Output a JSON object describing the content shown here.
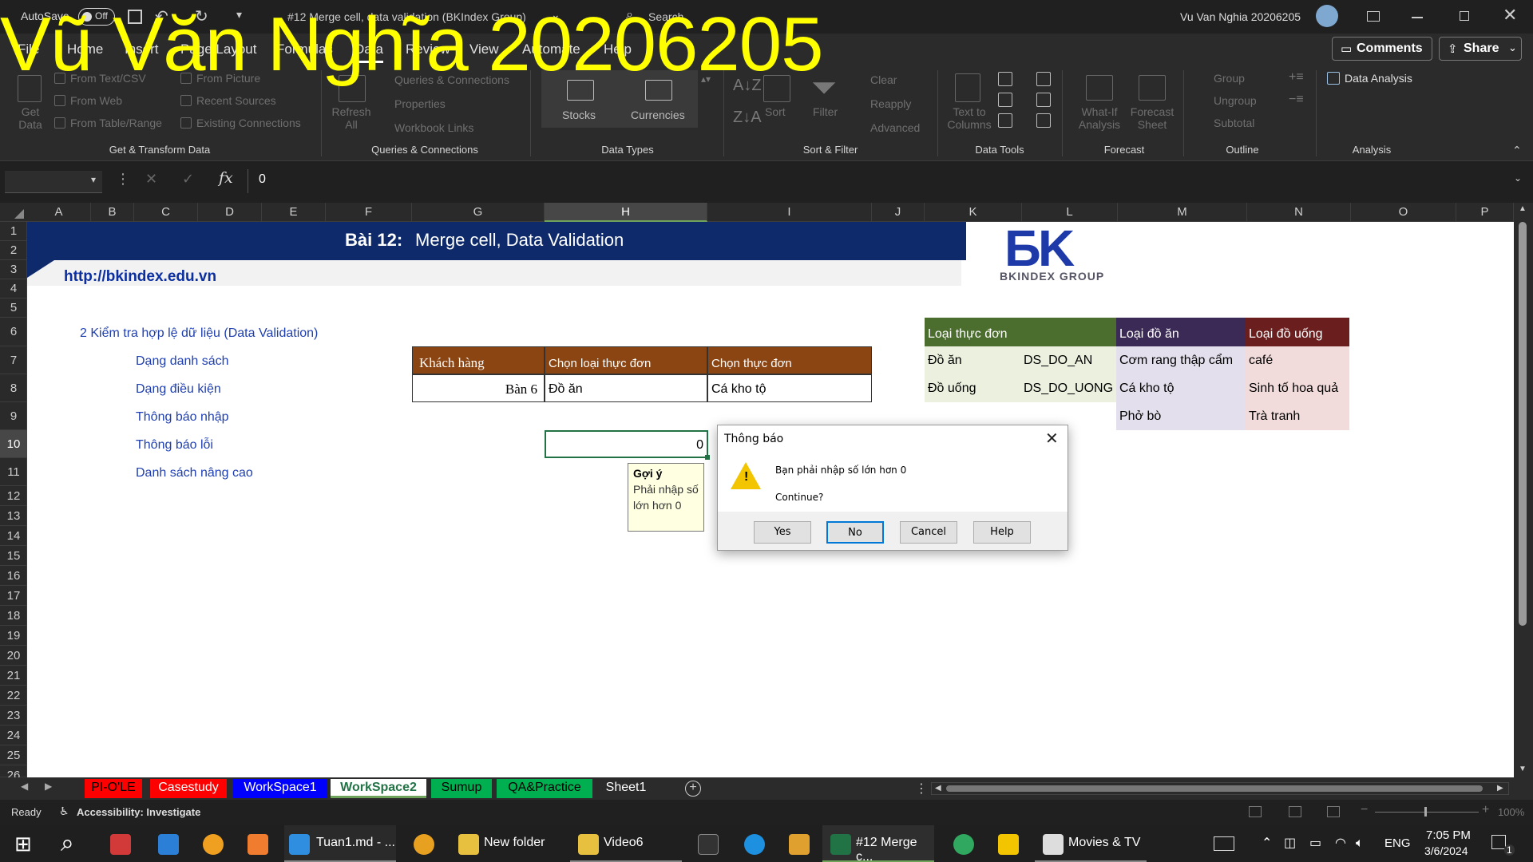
{
  "titlebar": {
    "autosave": "AutoSave",
    "toggle": "Off",
    "doc_title": "#12 Merge cell, data validation (BKIndex Group)",
    "search": "Search",
    "user": "Vu Van Nghia 20206205"
  },
  "watermark": "Vũ Văn Nghĩa 20206205",
  "menu": [
    "File",
    "Home",
    "Insert",
    "Page Layout",
    "Formulas",
    "Data",
    "Review",
    "View",
    "Automate",
    "Help"
  ],
  "menu_right": {
    "comments": "Comments",
    "share": "Share"
  },
  "ribbon": {
    "get_data": "Get Data",
    "from_text": "From Text/CSV",
    "from_web": "From Web",
    "from_table": "From Table/Range",
    "from_picture": "From Picture",
    "recent_sources": "Recent Sources",
    "existing_connections": "Existing Connections",
    "refresh": "Refresh All",
    "queries": "Queries & Connections",
    "properties": "Properties",
    "workbook_links": "Workbook Links",
    "stocks": "Stocks",
    "currencies": "Currencies",
    "sort": "Sort",
    "filter": "Filter",
    "clear": "Clear",
    "reapply": "Reapply",
    "advanced": "Advanced",
    "text_to_columns": "Text to Columns",
    "what_if": "What-If Analysis",
    "forecast_sheet": "Forecast Sheet",
    "group": "Group",
    "ungroup": "Ungroup",
    "subtotal": "Subtotal",
    "data_analysis": "Data Analysis",
    "groups": [
      "Get & Transform Data",
      "Queries & Connections",
      "Data Types",
      "Sort & Filter",
      "Data Tools",
      "Forecast",
      "Outline",
      "Analysis"
    ]
  },
  "formula": {
    "namebox": "",
    "fx": "fx",
    "value": "0"
  },
  "columns": [
    "A",
    "B",
    "C",
    "D",
    "E",
    "F",
    "G",
    "H",
    "I",
    "J",
    "K",
    "L",
    "M",
    "N",
    "O",
    "P"
  ],
  "rows": [
    "1",
    "2",
    "3",
    "4",
    "5",
    "6",
    "7",
    "8",
    "9",
    "10",
    "11",
    "12",
    "13",
    "14",
    "15",
    "16",
    "17",
    "18",
    "19",
    "20",
    "21",
    "22",
    "23",
    "24",
    "25",
    "26"
  ],
  "sheet": {
    "banner_label": "Bài 12:",
    "banner_title": "Merge cell, Data Validation",
    "url": "http://bkindex.edu.vn",
    "logo_mark": "ƂK",
    "logo_text": "BKINDEX GROUP",
    "section": "2  Kiểm tra hợp lệ dữ liệu (Data Validation)",
    "items": [
      "Dạng danh sách",
      "Dạng điều kiện",
      "Thông báo nhập",
      "Thông báo lỗi",
      "Danh sách nâng cao"
    ],
    "table_headers": [
      "Khách hàng",
      "Chọn loại thực đơn",
      "Chọn thực đơn"
    ],
    "table_row": [
      "Bàn 6",
      "Đồ ăn",
      "Cá kho tộ"
    ],
    "active_value": "0",
    "tooltip_title": "Gợi ý",
    "tooltip_body1": "Phải nhập số",
    "tooltip_body2": "lớn hơn 0",
    "menu_headers": [
      "Loại thực đơn",
      "Loại đồ ăn",
      "Loại đồ uống"
    ],
    "menu_types": [
      [
        "Đồ ăn",
        "DS_DO_AN"
      ],
      [
        "Đồ uống",
        "DS_DO_UONG"
      ]
    ],
    "foods": [
      "Cơm rang thập cẩm",
      "Cá kho tộ",
      "Phở bò"
    ],
    "drinks": [
      "café",
      "Sinh tố hoa quả",
      "Trà tranh"
    ]
  },
  "dialog": {
    "title": "Thông báo",
    "message": "Bạn phải nhập số lớn hơn 0",
    "question": "Continue?",
    "yes": "Yes",
    "no": "No",
    "cancel": "Cancel",
    "help": "Help"
  },
  "tabs": [
    "PI-O'LE",
    "Casestudy",
    "WorkSpace1",
    "WorkSpace2",
    "Sumup",
    "QA&Practice",
    "Sheet1"
  ],
  "tab_colors": [
    "#ff0000",
    "#ff0000",
    "#0000ff",
    "#ffffff",
    "#00b050",
    "#00b050",
    "#2b2b2b"
  ],
  "status": {
    "ready": "Ready",
    "accessibility": "Accessibility: Investigate",
    "zoom": "100%"
  },
  "taskbar": {
    "vscode": "Tuan1.md - ...",
    "folder": "New folder",
    "video": "Video6",
    "excel": "#12 Merge c...",
    "movies": "Movies & TV",
    "lang": "ENG",
    "time": "7:05 PM",
    "date": "3/6/2024",
    "notif": "1"
  },
  "colors": {
    "banner": "#0e2a6b",
    "brown": "#8b4513",
    "green": "#4b6e2e",
    "purple": "#3b2a55",
    "maroon": "#6b1e1e",
    "select": "#217346"
  }
}
